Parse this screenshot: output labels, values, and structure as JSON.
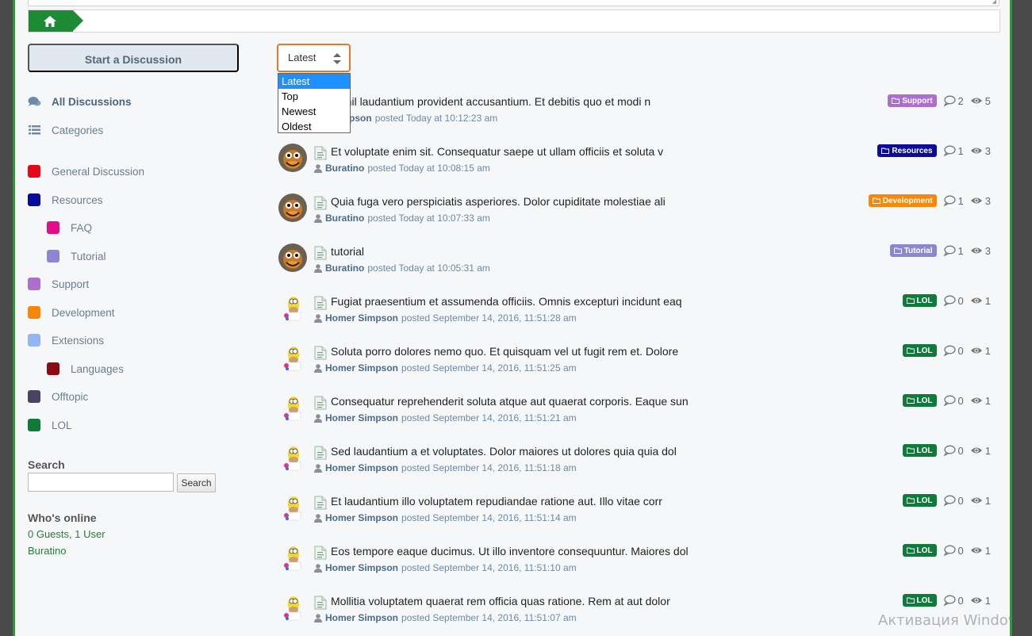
{
  "breadcrumb": {
    "home_icon": "home-icon"
  },
  "sidebar": {
    "start_label": "Start a Discussion",
    "nav": [
      {
        "label": "All Discussions",
        "icon": "comments-icon",
        "active": true
      },
      {
        "label": "Categories",
        "icon": "list-icon"
      }
    ],
    "categories": [
      {
        "label": "General Discussion",
        "color": "#e3091a"
      },
      {
        "label": "Resources",
        "color": "#0a0a9b"
      },
      {
        "label": "FAQ",
        "color": "#e40d88"
      },
      {
        "label": "Tutorial",
        "color": "#8a87d0"
      },
      {
        "label": "Support",
        "color": "#ad6fcd"
      },
      {
        "label": "Development",
        "color": "#f7870b"
      },
      {
        "label": "Extensions",
        "color": "#95b6f0"
      },
      {
        "label": "Languages",
        "color": "#8c0a11"
      },
      {
        "label": "Offtopic",
        "color": "#4b4461"
      },
      {
        "label": "LOL",
        "color": "#0f7a3a"
      }
    ],
    "search_title": "Search",
    "search_button": "Search",
    "online_title": "Who's online",
    "online_count": "0 Guests, 1 User",
    "online_user": "Buratino"
  },
  "sort": {
    "selected": "Latest",
    "options": [
      "Latest",
      "Top",
      "Newest",
      "Oldest"
    ]
  },
  "discussions": [
    {
      "title": "t nihil laudantium provident accusantium. Et debitis quo et modi n",
      "user": "r Simpson",
      "posted": "posted Today at 10:12:23 am",
      "tag": "Support",
      "tag_color": "#ad6fcd",
      "replies": "2",
      "views": "5",
      "avatar": "none"
    },
    {
      "title": "Et voluptate enim sit. Consequatur saepe ut ullam officiis et soluta v",
      "user": "Buratino",
      "posted": "posted Today at 10:08:15 am",
      "tag": "Resources",
      "tag_color": "#0a0a9b",
      "replies": "1",
      "views": "3",
      "avatar": "buratino"
    },
    {
      "title": "Quia fuga vero perspiciatis asperiores. Dolor cupiditate molestiae ali",
      "user": "Buratino",
      "posted": "posted Today at 10:07:33 am",
      "tag": "Development",
      "tag_color": "#f7870b",
      "replies": "1",
      "views": "3",
      "avatar": "buratino"
    },
    {
      "title": "tutorial",
      "user": "Buratino",
      "posted": "posted Today at 10:05:31 am",
      "tag": "Tutorial",
      "tag_color": "#8a87d0",
      "replies": "1",
      "views": "3",
      "avatar": "buratino"
    },
    {
      "title": "Fugiat praesentium et assumenda officiis. Omnis excepturi incidunt eaq",
      "user": "Homer Simpson",
      "posted": "posted September 14, 2016, 11:51:28 am",
      "tag": "LOL",
      "tag_color": "#0f7a3a",
      "replies": "0",
      "views": "1",
      "avatar": "homer"
    },
    {
      "title": "Soluta porro dolores nemo quo. Et quisquam vel ut fugit rem et. Dolore",
      "user": "Homer Simpson",
      "posted": "posted September 14, 2016, 11:51:25 am",
      "tag": "LOL",
      "tag_color": "#0f7a3a",
      "replies": "0",
      "views": "1",
      "avatar": "homer"
    },
    {
      "title": "Consequatur reprehenderit soluta atque aut quaerat corporis. Eaque sun",
      "user": "Homer Simpson",
      "posted": "posted September 14, 2016, 11:51:21 am",
      "tag": "LOL",
      "tag_color": "#0f7a3a",
      "replies": "0",
      "views": "1",
      "avatar": "homer"
    },
    {
      "title": "Sed laudantium a et voluptates. Dolor maiores ut dolores quia quia dol",
      "user": "Homer Simpson",
      "posted": "posted September 14, 2016, 11:51:18 am",
      "tag": "LOL",
      "tag_color": "#0f7a3a",
      "replies": "0",
      "views": "1",
      "avatar": "homer"
    },
    {
      "title": "Et laudantium illo voluptatem repudiandae ratione aut. Illo vitae corr",
      "user": "Homer Simpson",
      "posted": "posted September 14, 2016, 11:51:14 am",
      "tag": "LOL",
      "tag_color": "#0f7a3a",
      "replies": "0",
      "views": "1",
      "avatar": "homer"
    },
    {
      "title": "Eos tempore eaque ducimus. Ut illo inventore consequuntur. Maiores dol",
      "user": "Homer Simpson",
      "posted": "posted September 14, 2016, 11:51:10 am",
      "tag": "LOL",
      "tag_color": "#0f7a3a",
      "replies": "0",
      "views": "1",
      "avatar": "homer"
    },
    {
      "title": "Mollitia voluptatem quaerat rem officia quas ratione. Rem at aut dolor",
      "user": "Homer Simpson",
      "posted": "posted September 14, 2016, 11:51:07 am",
      "tag": "LOL",
      "tag_color": "#0f7a3a",
      "replies": "0",
      "views": "1",
      "avatar": "homer"
    }
  ],
  "watermark": "Активация Windows"
}
